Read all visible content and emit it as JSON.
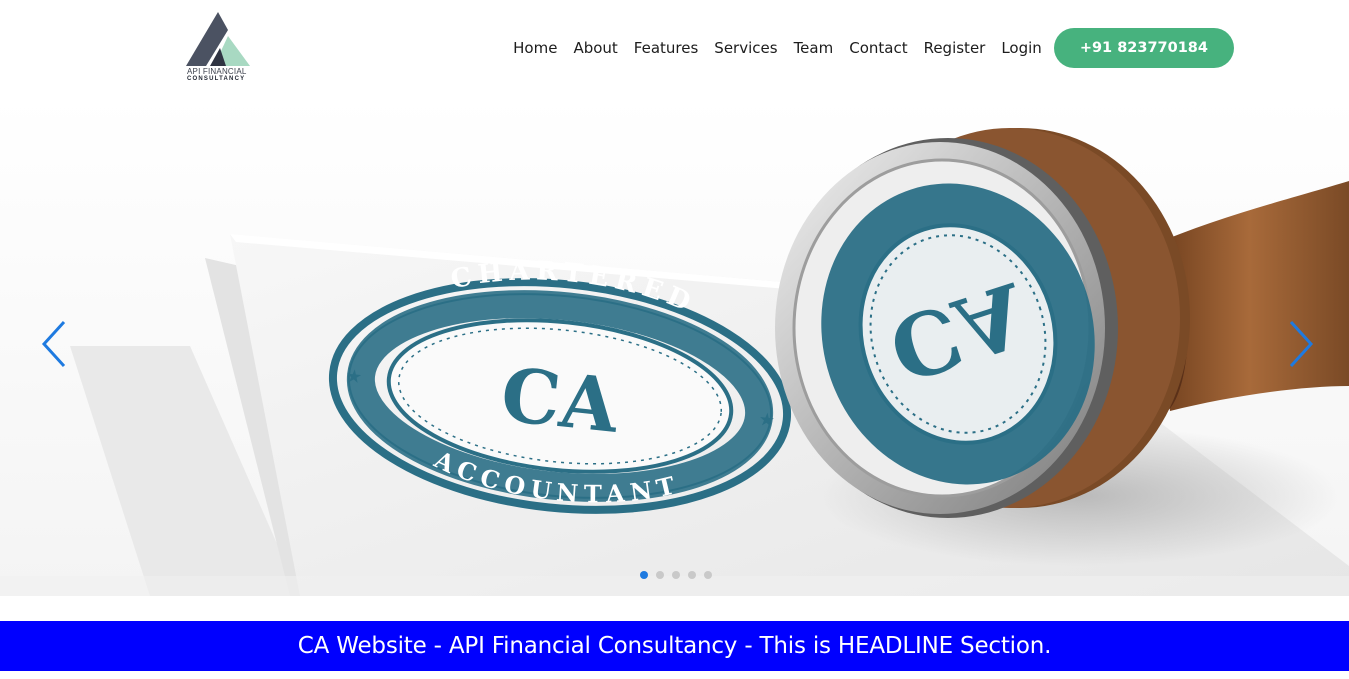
{
  "logo": {
    "line1": "API FINANCIAL",
    "line2": "CONSULTANCY"
  },
  "nav": {
    "items": [
      "Home",
      "About",
      "Features",
      "Services",
      "Team",
      "Contact",
      "Register",
      "Login"
    ],
    "phone_label": "+91 823770184"
  },
  "carousel": {
    "stamp_ring_top": "CHARTERED",
    "stamp_ring_bottom": "ACCOUNTANT",
    "stamp_center": "CA",
    "slide_count": 5,
    "active_slide": 1
  },
  "headline": {
    "text": "CA Website - API Financial Consultancy - This is HEADLINE Section."
  },
  "colors": {
    "accent_green": "#47b27e",
    "headline_blue": "#0000ff",
    "arrow_blue": "#1e7ae0",
    "stamp_teal": "#2b6f86"
  },
  "icons": {
    "prev": "chevron-left-icon",
    "next": "chevron-right-icon"
  }
}
